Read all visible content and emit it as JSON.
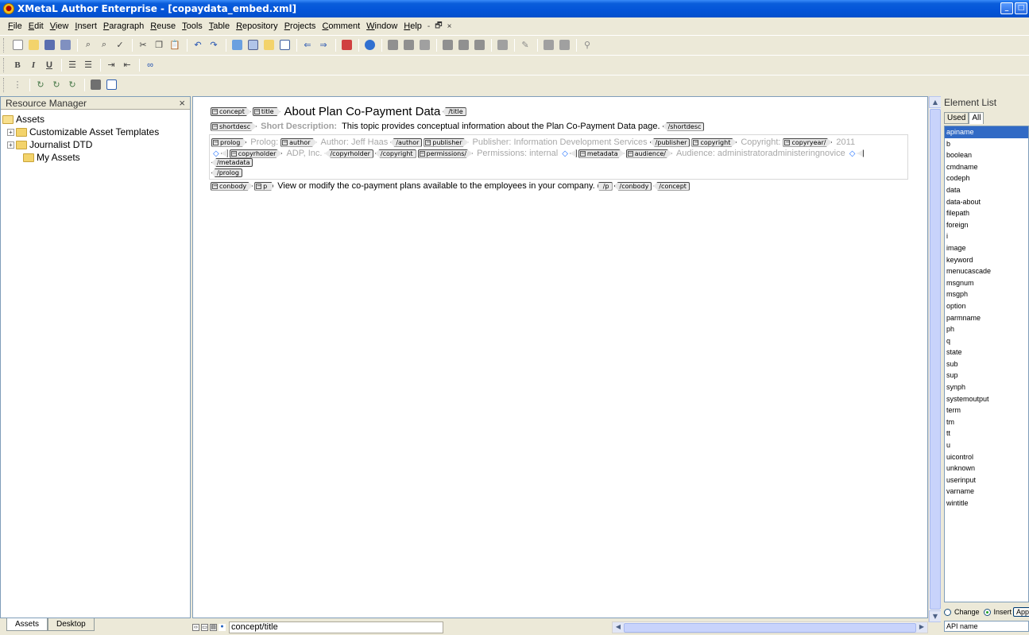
{
  "window": {
    "title": "XMetaL Author Enterprise - [copaydata_embed.xml]",
    "controls": [
      "_",
      "□"
    ]
  },
  "menu": {
    "items": [
      "File",
      "Edit",
      "View",
      "Insert",
      "Paragraph",
      "Reuse",
      "Tools",
      "Table",
      "Repository",
      "Projects",
      "Comment",
      "Window",
      "Help"
    ],
    "mdi_controls": [
      "-",
      "🗗",
      "×"
    ]
  },
  "toolbar_format": {
    "bold": "B",
    "italic": "I",
    "underline": "U"
  },
  "resource_manager": {
    "title": "Resource Manager",
    "close": "×",
    "tree": [
      {
        "label": "Assets"
      },
      {
        "label": "Customizable Asset Templates"
      },
      {
        "label": "Journalist DTD"
      },
      {
        "label": "My Assets"
      }
    ],
    "tabs": [
      "Assets",
      "Desktop"
    ]
  },
  "document": {
    "title_tags": {
      "concept": "concept",
      "title": "title",
      "title_close": "/title"
    },
    "title_text": "About Plan Co-Payment Data",
    "shortdesc": {
      "open": "shortdesc",
      "label": "Short Description:",
      "text": "This topic provides conceptual information about the Plan Co-Payment Data page.",
      "close": "/shortdesc"
    },
    "prolog": {
      "open": "prolog",
      "label": "Prolog:",
      "author_tag": "author",
      "author_text": "Author: Jeff Haas",
      "author_close": "/author",
      "publisher_tag": "publisher",
      "publisher_text": "Publisher: Information Development Services",
      "publisher_close": "/publisher",
      "copyright_tag": "copyright",
      "copyright_label": "Copyright:",
      "copyryear_tag": "copyryear/",
      "copyright_year": "2011",
      "copyrholder_tag": "copyrholder",
      "copyrholder_text": "ADP, Inc.",
      "copyrholder_close": "/copyrholder",
      "copyright_close": "/copyright",
      "permissions_tag": "permissions/",
      "permissions_text": "Permissions: internal",
      "metadata_tag": "metadata",
      "audience_tag": "audience/",
      "audience_text": "Audience: administratoradministeringnovice",
      "metadata_close": "/metadata",
      "close": "/prolog"
    },
    "body": {
      "conbody": "conbody",
      "p": "p",
      "text": "View or modify the co-payment plans available to the employees in your company.",
      "p_close": "/p",
      "conbody_close": "/conbody",
      "concept_close": "/concept"
    }
  },
  "status": {
    "path": "concept/title"
  },
  "element_list": {
    "title": "Element List",
    "tabs": [
      "Used",
      "All"
    ],
    "items": [
      "apiname",
      "b",
      "boolean",
      "cmdname",
      "codeph",
      "data",
      "data-about",
      "filepath",
      "foreign",
      "i",
      "image",
      "keyword",
      "menucascade",
      "msgnum",
      "msgph",
      "option",
      "parmname",
      "ph",
      "q",
      "state",
      "sub",
      "sup",
      "synph",
      "systemoutput",
      "term",
      "tm",
      "tt",
      "u",
      "uicontrol",
      "unknown",
      "userinput",
      "varname",
      "wintitle"
    ],
    "selected": "apiname",
    "mode_change": "Change",
    "mode_insert": "Insert",
    "apply": "Apply",
    "attr_header": "API name"
  },
  "colors": {
    "titlebar": "#0454d8",
    "selection": "#316ac5",
    "tag_bg": "#e8e8e8"
  }
}
